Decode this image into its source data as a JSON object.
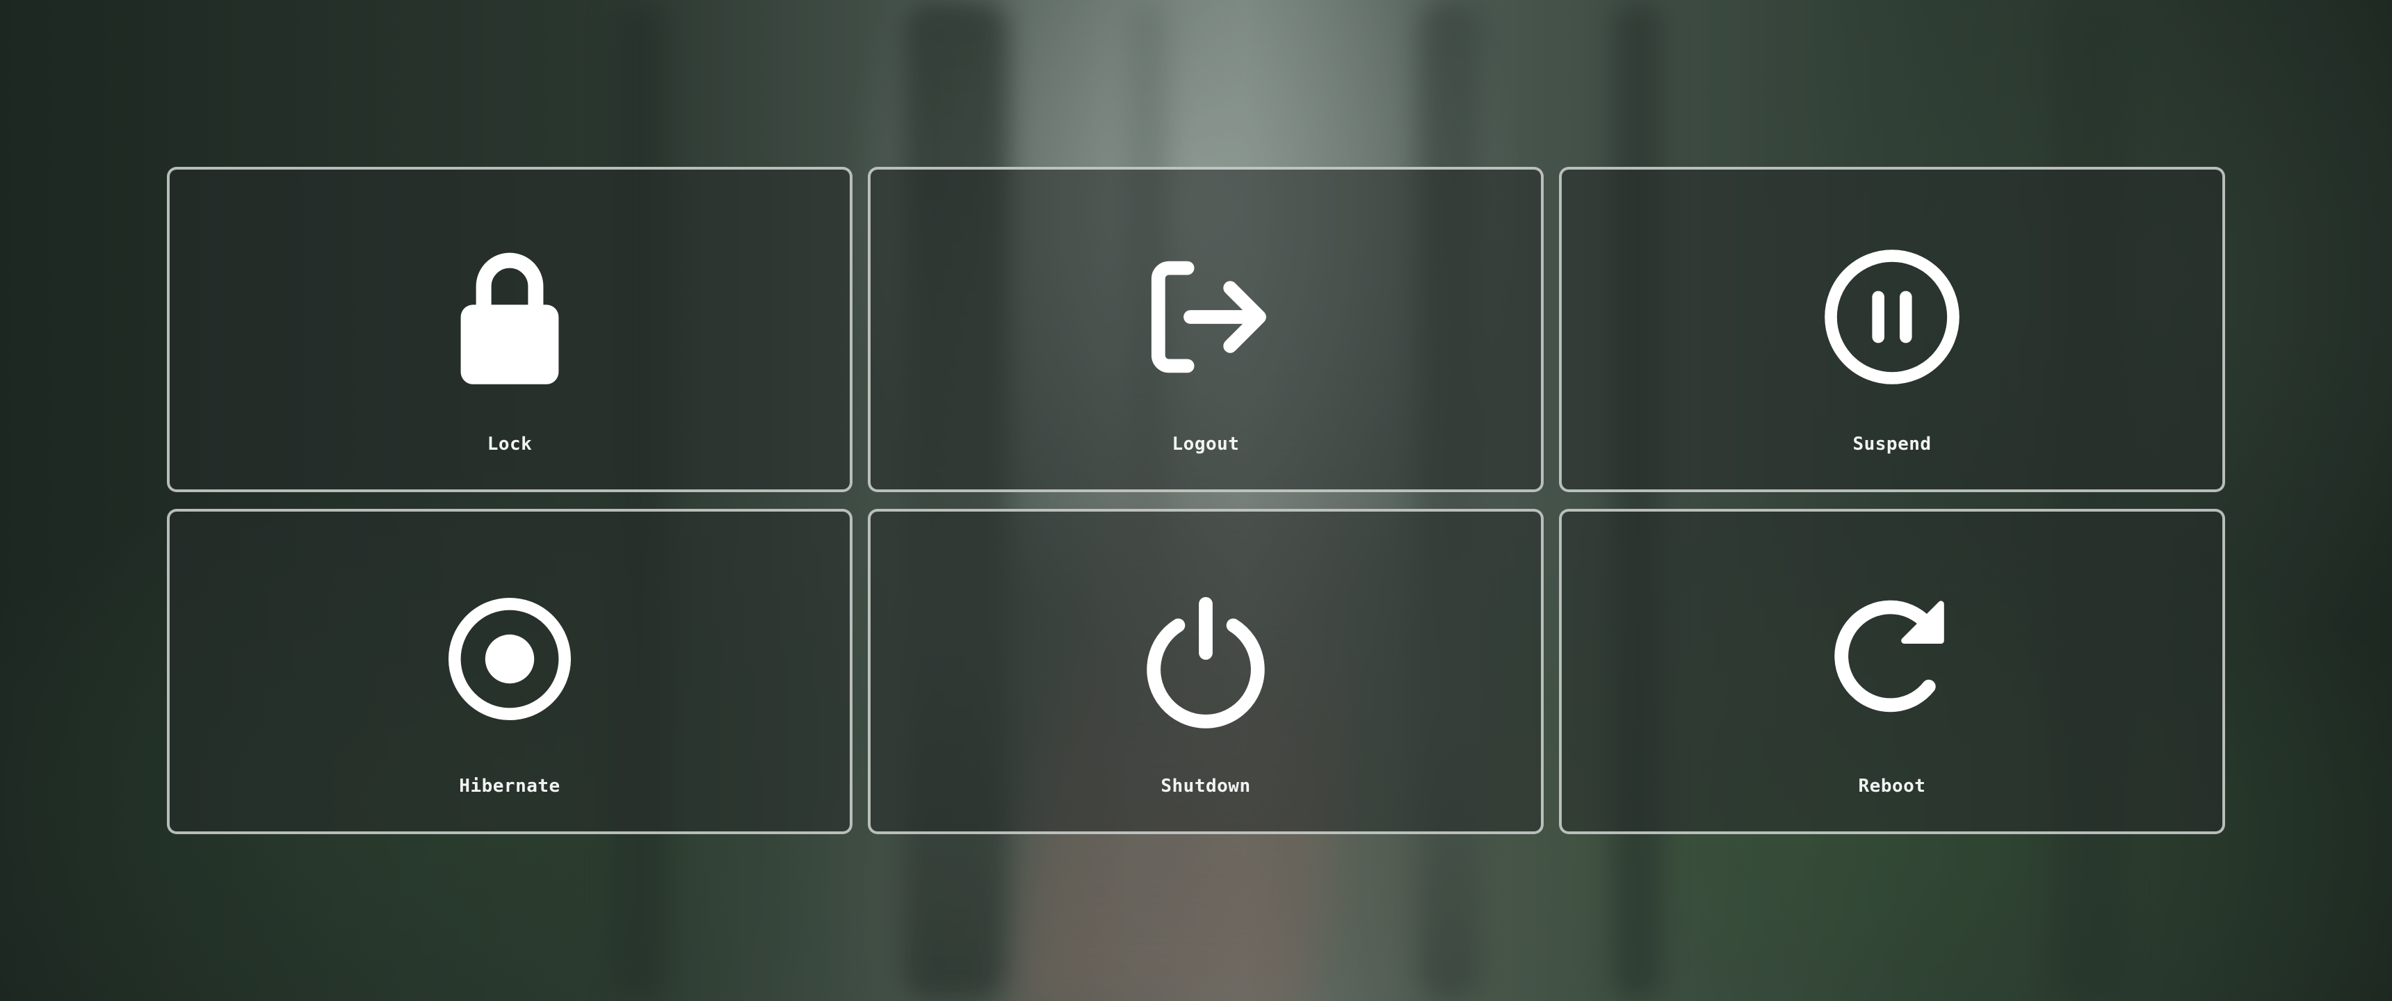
{
  "menu": {
    "items": [
      {
        "id": "lock",
        "label": "Lock",
        "icon": "lock-icon"
      },
      {
        "id": "logout",
        "label": "Logout",
        "icon": "logout-icon"
      },
      {
        "id": "suspend",
        "label": "Suspend",
        "icon": "pause-icon"
      },
      {
        "id": "hibernate",
        "label": "Hibernate",
        "icon": "record-icon"
      },
      {
        "id": "shutdown",
        "label": "Shutdown",
        "icon": "power-icon"
      },
      {
        "id": "reboot",
        "label": "Reboot",
        "icon": "reboot-icon"
      }
    ]
  },
  "theme": {
    "tile_border": "#d2d7d4",
    "tile_background": "#262c29",
    "icon_color": "#ffffff",
    "label_color": "#f2f4f3"
  }
}
